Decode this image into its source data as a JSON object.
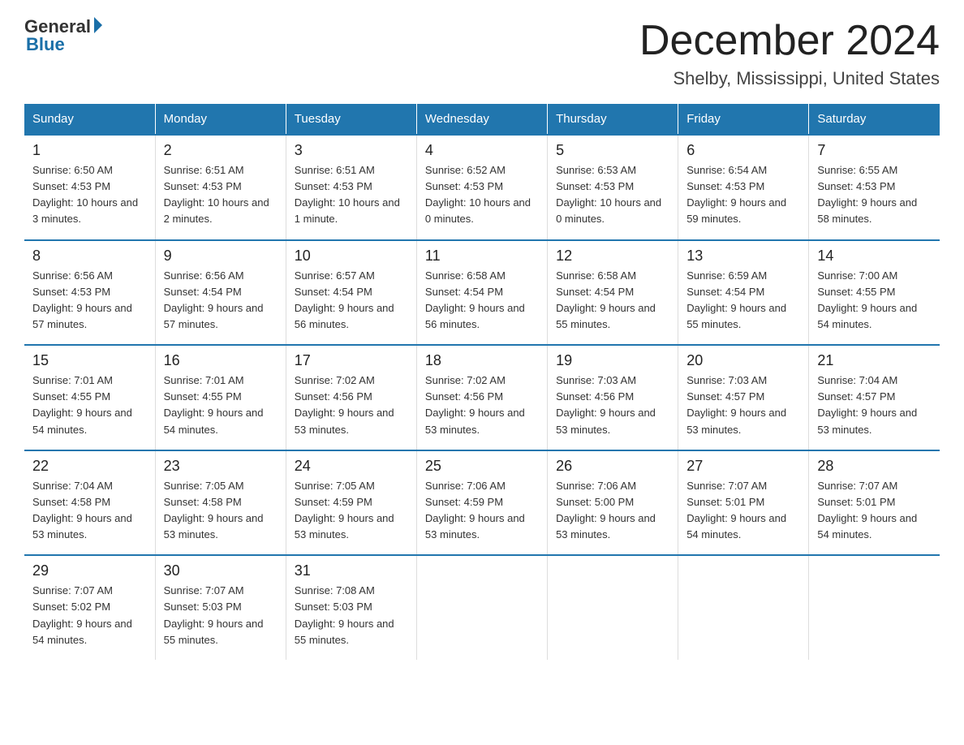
{
  "header": {
    "logo_general": "General",
    "logo_blue": "Blue",
    "month_title": "December 2024",
    "location": "Shelby, Mississippi, United States"
  },
  "weekdays": [
    "Sunday",
    "Monday",
    "Tuesday",
    "Wednesday",
    "Thursday",
    "Friday",
    "Saturday"
  ],
  "weeks": [
    [
      {
        "day": "1",
        "sunrise": "Sunrise: 6:50 AM",
        "sunset": "Sunset: 4:53 PM",
        "daylight": "Daylight: 10 hours and 3 minutes."
      },
      {
        "day": "2",
        "sunrise": "Sunrise: 6:51 AM",
        "sunset": "Sunset: 4:53 PM",
        "daylight": "Daylight: 10 hours and 2 minutes."
      },
      {
        "day": "3",
        "sunrise": "Sunrise: 6:51 AM",
        "sunset": "Sunset: 4:53 PM",
        "daylight": "Daylight: 10 hours and 1 minute."
      },
      {
        "day": "4",
        "sunrise": "Sunrise: 6:52 AM",
        "sunset": "Sunset: 4:53 PM",
        "daylight": "Daylight: 10 hours and 0 minutes."
      },
      {
        "day": "5",
        "sunrise": "Sunrise: 6:53 AM",
        "sunset": "Sunset: 4:53 PM",
        "daylight": "Daylight: 10 hours and 0 minutes."
      },
      {
        "day": "6",
        "sunrise": "Sunrise: 6:54 AM",
        "sunset": "Sunset: 4:53 PM",
        "daylight": "Daylight: 9 hours and 59 minutes."
      },
      {
        "day": "7",
        "sunrise": "Sunrise: 6:55 AM",
        "sunset": "Sunset: 4:53 PM",
        "daylight": "Daylight: 9 hours and 58 minutes."
      }
    ],
    [
      {
        "day": "8",
        "sunrise": "Sunrise: 6:56 AM",
        "sunset": "Sunset: 4:53 PM",
        "daylight": "Daylight: 9 hours and 57 minutes."
      },
      {
        "day": "9",
        "sunrise": "Sunrise: 6:56 AM",
        "sunset": "Sunset: 4:54 PM",
        "daylight": "Daylight: 9 hours and 57 minutes."
      },
      {
        "day": "10",
        "sunrise": "Sunrise: 6:57 AM",
        "sunset": "Sunset: 4:54 PM",
        "daylight": "Daylight: 9 hours and 56 minutes."
      },
      {
        "day": "11",
        "sunrise": "Sunrise: 6:58 AM",
        "sunset": "Sunset: 4:54 PM",
        "daylight": "Daylight: 9 hours and 56 minutes."
      },
      {
        "day": "12",
        "sunrise": "Sunrise: 6:58 AM",
        "sunset": "Sunset: 4:54 PM",
        "daylight": "Daylight: 9 hours and 55 minutes."
      },
      {
        "day": "13",
        "sunrise": "Sunrise: 6:59 AM",
        "sunset": "Sunset: 4:54 PM",
        "daylight": "Daylight: 9 hours and 55 minutes."
      },
      {
        "day": "14",
        "sunrise": "Sunrise: 7:00 AM",
        "sunset": "Sunset: 4:55 PM",
        "daylight": "Daylight: 9 hours and 54 minutes."
      }
    ],
    [
      {
        "day": "15",
        "sunrise": "Sunrise: 7:01 AM",
        "sunset": "Sunset: 4:55 PM",
        "daylight": "Daylight: 9 hours and 54 minutes."
      },
      {
        "day": "16",
        "sunrise": "Sunrise: 7:01 AM",
        "sunset": "Sunset: 4:55 PM",
        "daylight": "Daylight: 9 hours and 54 minutes."
      },
      {
        "day": "17",
        "sunrise": "Sunrise: 7:02 AM",
        "sunset": "Sunset: 4:56 PM",
        "daylight": "Daylight: 9 hours and 53 minutes."
      },
      {
        "day": "18",
        "sunrise": "Sunrise: 7:02 AM",
        "sunset": "Sunset: 4:56 PM",
        "daylight": "Daylight: 9 hours and 53 minutes."
      },
      {
        "day": "19",
        "sunrise": "Sunrise: 7:03 AM",
        "sunset": "Sunset: 4:56 PM",
        "daylight": "Daylight: 9 hours and 53 minutes."
      },
      {
        "day": "20",
        "sunrise": "Sunrise: 7:03 AM",
        "sunset": "Sunset: 4:57 PM",
        "daylight": "Daylight: 9 hours and 53 minutes."
      },
      {
        "day": "21",
        "sunrise": "Sunrise: 7:04 AM",
        "sunset": "Sunset: 4:57 PM",
        "daylight": "Daylight: 9 hours and 53 minutes."
      }
    ],
    [
      {
        "day": "22",
        "sunrise": "Sunrise: 7:04 AM",
        "sunset": "Sunset: 4:58 PM",
        "daylight": "Daylight: 9 hours and 53 minutes."
      },
      {
        "day": "23",
        "sunrise": "Sunrise: 7:05 AM",
        "sunset": "Sunset: 4:58 PM",
        "daylight": "Daylight: 9 hours and 53 minutes."
      },
      {
        "day": "24",
        "sunrise": "Sunrise: 7:05 AM",
        "sunset": "Sunset: 4:59 PM",
        "daylight": "Daylight: 9 hours and 53 minutes."
      },
      {
        "day": "25",
        "sunrise": "Sunrise: 7:06 AM",
        "sunset": "Sunset: 4:59 PM",
        "daylight": "Daylight: 9 hours and 53 minutes."
      },
      {
        "day": "26",
        "sunrise": "Sunrise: 7:06 AM",
        "sunset": "Sunset: 5:00 PM",
        "daylight": "Daylight: 9 hours and 53 minutes."
      },
      {
        "day": "27",
        "sunrise": "Sunrise: 7:07 AM",
        "sunset": "Sunset: 5:01 PM",
        "daylight": "Daylight: 9 hours and 54 minutes."
      },
      {
        "day": "28",
        "sunrise": "Sunrise: 7:07 AM",
        "sunset": "Sunset: 5:01 PM",
        "daylight": "Daylight: 9 hours and 54 minutes."
      }
    ],
    [
      {
        "day": "29",
        "sunrise": "Sunrise: 7:07 AM",
        "sunset": "Sunset: 5:02 PM",
        "daylight": "Daylight: 9 hours and 54 minutes."
      },
      {
        "day": "30",
        "sunrise": "Sunrise: 7:07 AM",
        "sunset": "Sunset: 5:03 PM",
        "daylight": "Daylight: 9 hours and 55 minutes."
      },
      {
        "day": "31",
        "sunrise": "Sunrise: 7:08 AM",
        "sunset": "Sunset: 5:03 PM",
        "daylight": "Daylight: 9 hours and 55 minutes."
      },
      {
        "day": "",
        "sunrise": "",
        "sunset": "",
        "daylight": ""
      },
      {
        "day": "",
        "sunrise": "",
        "sunset": "",
        "daylight": ""
      },
      {
        "day": "",
        "sunrise": "",
        "sunset": "",
        "daylight": ""
      },
      {
        "day": "",
        "sunrise": "",
        "sunset": "",
        "daylight": ""
      }
    ]
  ]
}
